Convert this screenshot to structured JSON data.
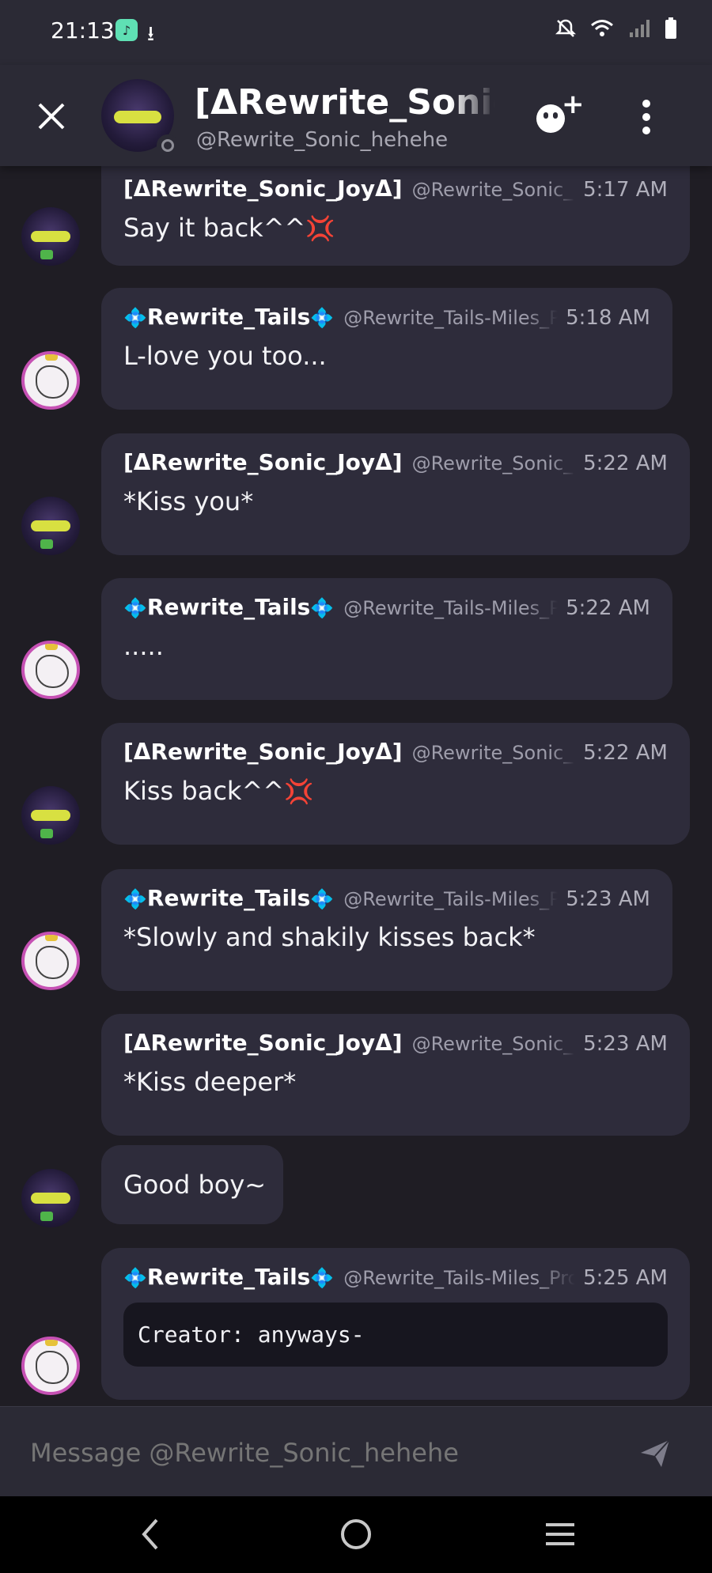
{
  "status_bar": {
    "time": "21:13",
    "icons": [
      "app-notification-icon",
      "download-icon",
      "mute-icon",
      "wifi-icon",
      "signal-icon",
      "battery-icon"
    ]
  },
  "header": {
    "title": "[ΔRewrite_Sonic_JoyΔ]",
    "handle": "@Rewrite_Sonic_hehehe"
  },
  "messages": [
    {
      "author": "[ΔRewrite_Sonic_JoyΔ]",
      "handle": "@Rewrite_Sonic_hehehe",
      "time": "5:17 AM",
      "text": "Say it back^^",
      "emoji": "💢"
    },
    {
      "author": "Rewrite_Tails",
      "handle": "@Rewrite_Tails-Miles_Prower",
      "time": "5:18 AM",
      "text": "L-love you too..."
    },
    {
      "author": "[ΔRewrite_Sonic_JoyΔ]",
      "handle": "@Rewrite_Sonic_hehehe",
      "time": "5:22 AM",
      "text": "*Kiss you*"
    },
    {
      "author": "Rewrite_Tails",
      "handle": "@Rewrite_Tails-Miles_Prower",
      "time": "5:22 AM",
      "text": "....."
    },
    {
      "author": "[ΔRewrite_Sonic_JoyΔ]",
      "handle": "@Rewrite_Sonic_hehehe",
      "time": "5:22 AM",
      "text": "Kiss back^^",
      "emoji": "💢"
    },
    {
      "author": "Rewrite_Tails",
      "handle": "@Rewrite_Tails-Miles_Prower",
      "time": "5:23 AM",
      "text": "*Slowly and shakily kisses back*"
    },
    {
      "author": "[ΔRewrite_Sonic_JoyΔ]",
      "handle": "@Rewrite_Sonic_hehehe",
      "time": "5:23 AM",
      "text": "*Kiss deeper*"
    },
    {
      "text": "Good boy~"
    },
    {
      "author": "Rewrite_Tails",
      "handle": "@Rewrite_Tails-Miles_Prower",
      "time": "5:25 AM",
      "code": "Creator: anyways-"
    }
  ],
  "composer": {
    "placeholder": "Message @Rewrite_Sonic_hehehe"
  },
  "colors": {
    "background": "#1f1d24",
    "bar": "#2b2a35",
    "bubble": "#2e2c3b",
    "accent_diamond": "#3aa4ff",
    "tails_ring": "#c651b4",
    "sonic_eyes": "#d8e041"
  }
}
